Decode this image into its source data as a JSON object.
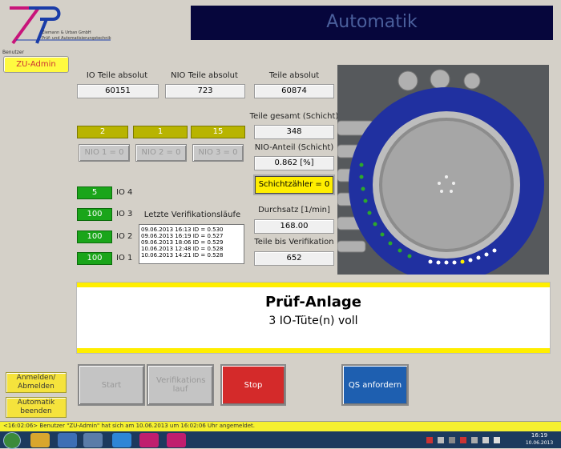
{
  "header": {
    "logo_line1": "Ziemann & Urban GmbH",
    "logo_line2": "Prüf- und Automatisierungstechnik",
    "title": "Automatik",
    "benutzer_label": "Benutzer",
    "user_button": "ZU-Admin"
  },
  "counters": {
    "io_label": "IO Teile absolut",
    "io_value": "60151",
    "nio_label": "NIO Teile absolut",
    "nio_value": "723",
    "total_label": "Teile absolut",
    "total_value": "60874",
    "shift_total_label": "Teile gesamt (Schicht)",
    "shift_total_value": "348",
    "nio_share_label": "NIO-Anteil (Schicht)",
    "nio_share_value": "0.862 [%]",
    "reset_button": "Schichtzähler = 0",
    "throughput_label": "Durchsatz [1/min]",
    "throughput_value": "168.00",
    "until_verif_label": "Teile bis Verifikation",
    "until_verif_value": "652"
  },
  "nio_groups": [
    {
      "count": "2",
      "button": "NIO 1 = 0"
    },
    {
      "count": "1",
      "button": "NIO 2 = 0"
    },
    {
      "count": "15",
      "button": "NIO 3 = 0"
    }
  ],
  "io_groups": [
    {
      "value": "5",
      "label": "IO 4"
    },
    {
      "value": "100",
      "label": "IO 3"
    },
    {
      "value": "100",
      "label": "IO 2"
    },
    {
      "value": "100",
      "label": "IO 1"
    }
  ],
  "verification": {
    "label": "Letzte Verifikationsläufe",
    "entries": [
      "09.06.2013 16:13 ID = 0.530",
      "09.06.2013 16:19 ID = 0.527",
      "09.06.2013 18:06 ID = 0.529",
      "10.06.2013 12:48 ID = 0.528",
      "10.06.2013 14:21 ID = 0.528"
    ]
  },
  "message": {
    "title": "Prüf-Anlage",
    "text": "3 IO-Tüte(n) voll"
  },
  "side_buttons": {
    "login": "Anmelden/ Abmelden",
    "exit": "Automatik beenden"
  },
  "buttons": {
    "start": "Start",
    "verif": "Verifikations lauf",
    "stop": "Stop",
    "qs": "QS anfordern"
  },
  "status_bar": "<16:02:06> Benutzer \"ZU-Admin\" hat sich am 10.06.2013 um 16:02:06 Uhr angemeldet.",
  "taskbar": {
    "time": "16:19",
    "date": "10.06.2013"
  },
  "colors": {
    "title_bg": "#06063c",
    "title_fg": "#4a5f9c",
    "accent_yellow": "#ffee00",
    "green": "#1aa51a",
    "stop_red": "#d42a2a",
    "qs_blue": "#1e5fb0"
  }
}
